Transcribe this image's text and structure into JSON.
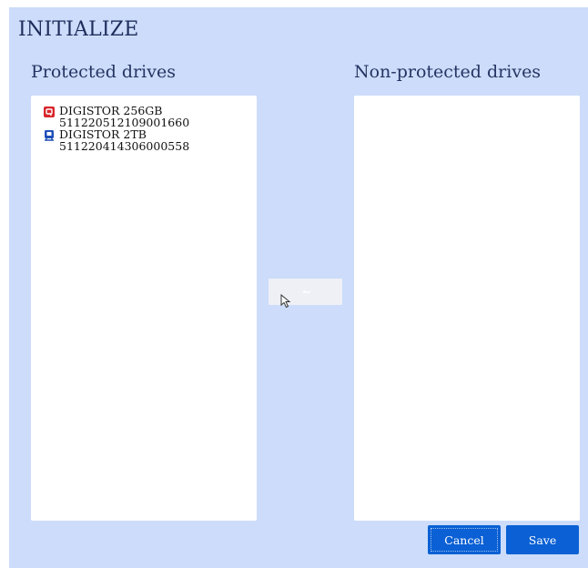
{
  "dialog": {
    "title": "INITIALIZE"
  },
  "protected": {
    "label": "Protected drives",
    "drives": [
      {
        "name": "DIGISTOR 256GB",
        "serial": "511220512109001660",
        "icon": "red-lock-drive-icon",
        "color": "#d8262b"
      },
      {
        "name": "DIGISTOR 2TB",
        "serial": "511220414306000558",
        "icon": "blue-drive-icon",
        "color": "#1f4fb8"
      }
    ]
  },
  "nonprotected": {
    "label": "Non-protected drives"
  },
  "transfer": {
    "icon": "arrow-left-icon"
  },
  "actions": {
    "cancel_label": "Cancel",
    "save_label": "Save"
  },
  "colors": {
    "background": "#ccdcfa",
    "button": "#0a60d4",
    "title": "#1e2d5c"
  }
}
